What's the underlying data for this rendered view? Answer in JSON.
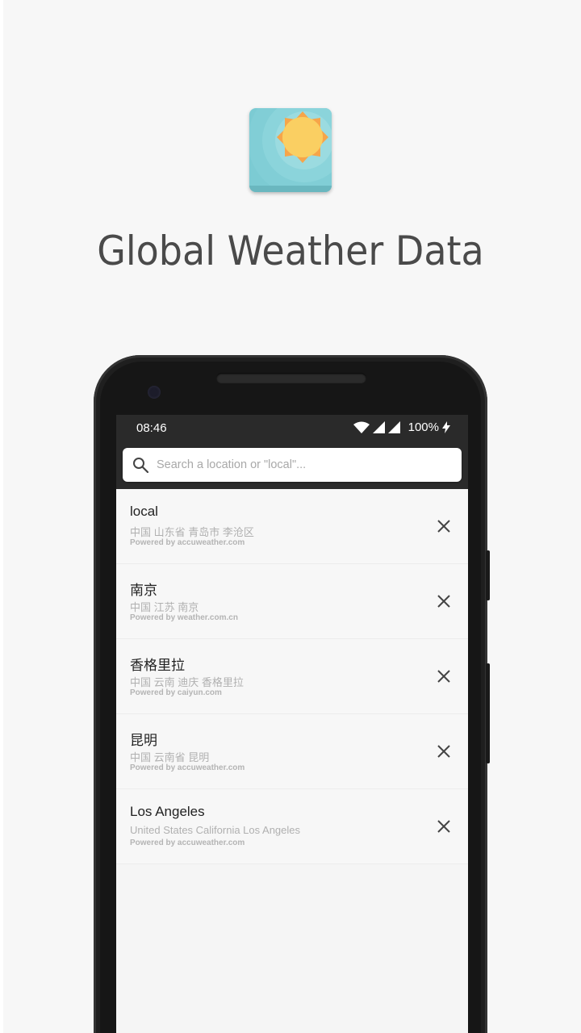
{
  "promo": {
    "headline": "Global Weather Data",
    "app_icon": "sunny-weather-app-icon"
  },
  "colors": {
    "background": "#f7f7f7",
    "phone_frame": "#1f1f1f",
    "toolbar": "#2a2a2a",
    "icon_sky": "#7ccbd3",
    "icon_sun": "#f9c956"
  },
  "status_bar": {
    "time": "08:46",
    "battery": "100%",
    "icons": [
      "wifi-icon",
      "signal-icon",
      "signal-icon",
      "charging-icon"
    ]
  },
  "search": {
    "placeholder": "Search a location or \"local\"...",
    "value": ""
  },
  "locations": [
    {
      "name": "local",
      "address": "中国 山东省 青岛市 李沧区",
      "source": "Powered by accuweather.com"
    },
    {
      "name": "南京",
      "address": "中国 江苏 南京",
      "source": "Powered by weather.com.cn"
    },
    {
      "name": "香格里拉",
      "address": "中国 云南 迪庆 香格里拉",
      "source": "Powered by caiyun.com"
    },
    {
      "name": "昆明",
      "address": "中国 云南省 昆明",
      "source": "Powered by accuweather.com"
    },
    {
      "name": "Los Angeles",
      "address": "United States California Los Angeles",
      "source": "Powered by accuweather.com"
    }
  ]
}
